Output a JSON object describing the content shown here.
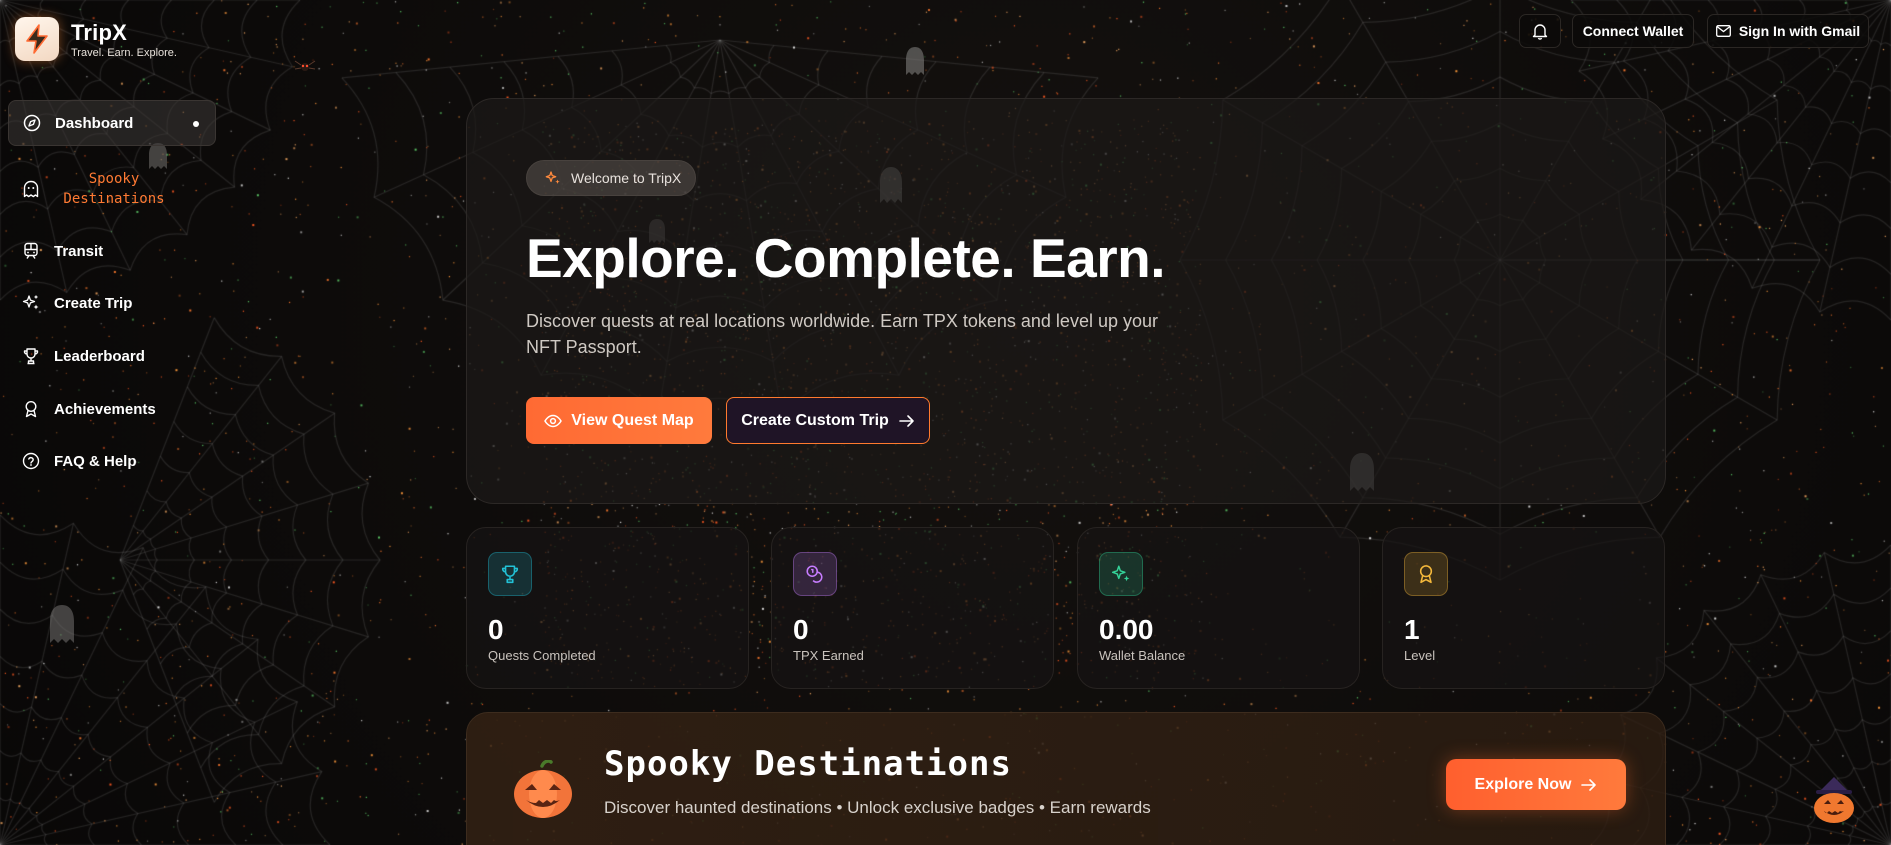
{
  "brand": {
    "name": "TripX",
    "tagline": "Travel. Earn. Explore."
  },
  "header": {
    "notifications_icon": "bell-icon",
    "connect_wallet": "Connect Wallet",
    "sign_in": "Sign In with Gmail",
    "sign_in_icon": "mail-icon"
  },
  "sidebar": {
    "items": [
      {
        "label": "Dashboard",
        "icon": "compass-icon",
        "active": true
      },
      {
        "label": "Spooky Destinations",
        "icon": "ghost-icon"
      },
      {
        "label": "Transit",
        "icon": "train-icon"
      },
      {
        "label": "Create Trip",
        "icon": "sparkles-icon"
      },
      {
        "label": "Leaderboard",
        "icon": "trophy-icon"
      },
      {
        "label": "Achievements",
        "icon": "award-icon"
      },
      {
        "label": "FAQ & Help",
        "icon": "help-circle-icon"
      }
    ]
  },
  "hero": {
    "badge": "Welcome to TripX",
    "title": "Explore. Complete. Earn.",
    "subtitle": "Discover quests at real locations worldwide. Earn TPX tokens and level up your NFT Passport.",
    "primary_button": "View Quest Map",
    "secondary_button": "Create Custom Trip"
  },
  "stats": [
    {
      "value": "0",
      "label": "Quests Completed",
      "icon": "trophy-icon",
      "color": "#22c1d6"
    },
    {
      "value": "0",
      "label": "TPX Earned",
      "icon": "coins-icon",
      "color": "#c77dff"
    },
    {
      "value": "0.00",
      "label": "Wallet Balance",
      "icon": "sparkles-icon",
      "color": "#34d399"
    },
    {
      "value": "1",
      "label": "Level",
      "icon": "award-icon",
      "color": "#f5b93b"
    }
  ],
  "spooky_banner": {
    "title": "Spooky Destinations",
    "subtitle": "Discover haunted destinations • Unlock exclusive badges • Earn rewards",
    "button": "Explore Now",
    "icon": "pumpkin-icon"
  },
  "colors": {
    "accent": "#ff6a33",
    "background": "#0b0908"
  }
}
